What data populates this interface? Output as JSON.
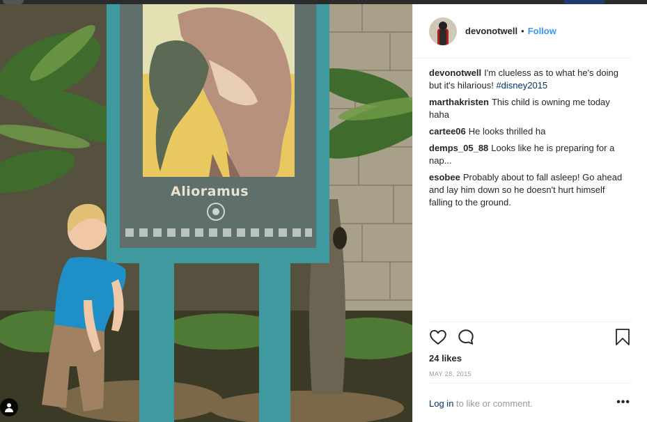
{
  "post": {
    "username": "devonotwell",
    "separator": "•",
    "follow_label": "Follow",
    "caption": {
      "user": "devonotwell",
      "text": "I'm clueless as to what he's doing but it's hilarious!",
      "hashtag": "#disney2015"
    },
    "comments": [
      {
        "user": "marthakristen",
        "text": "This child is owning me today haha"
      },
      {
        "user": "cartee06",
        "text": "He looks thrilled ha"
      },
      {
        "user": "demps_05_88",
        "text": "Looks like he is preparing for a nap..."
      },
      {
        "user": "esobee",
        "text": "Probably about to fall asleep! Go ahead and lay him down so he doesn't hurt himself falling to the ground."
      }
    ],
    "likes": "24 likes",
    "date": "MAY 28, 2015",
    "login_link": "Log in",
    "login_suffix": " to like or comment.",
    "more_label": "•••"
  },
  "photo": {
    "sign_title": "Alioramus"
  },
  "colors": {
    "link": "#3897f0",
    "hashtag": "#003569",
    "sign_frame": "#3b9ba0",
    "sign_panel": "#5f6f6c",
    "poster_bg": "#e9c85f"
  },
  "icons": [
    "heart-icon",
    "comment-icon",
    "bookmark-icon",
    "user-tag-icon"
  ]
}
